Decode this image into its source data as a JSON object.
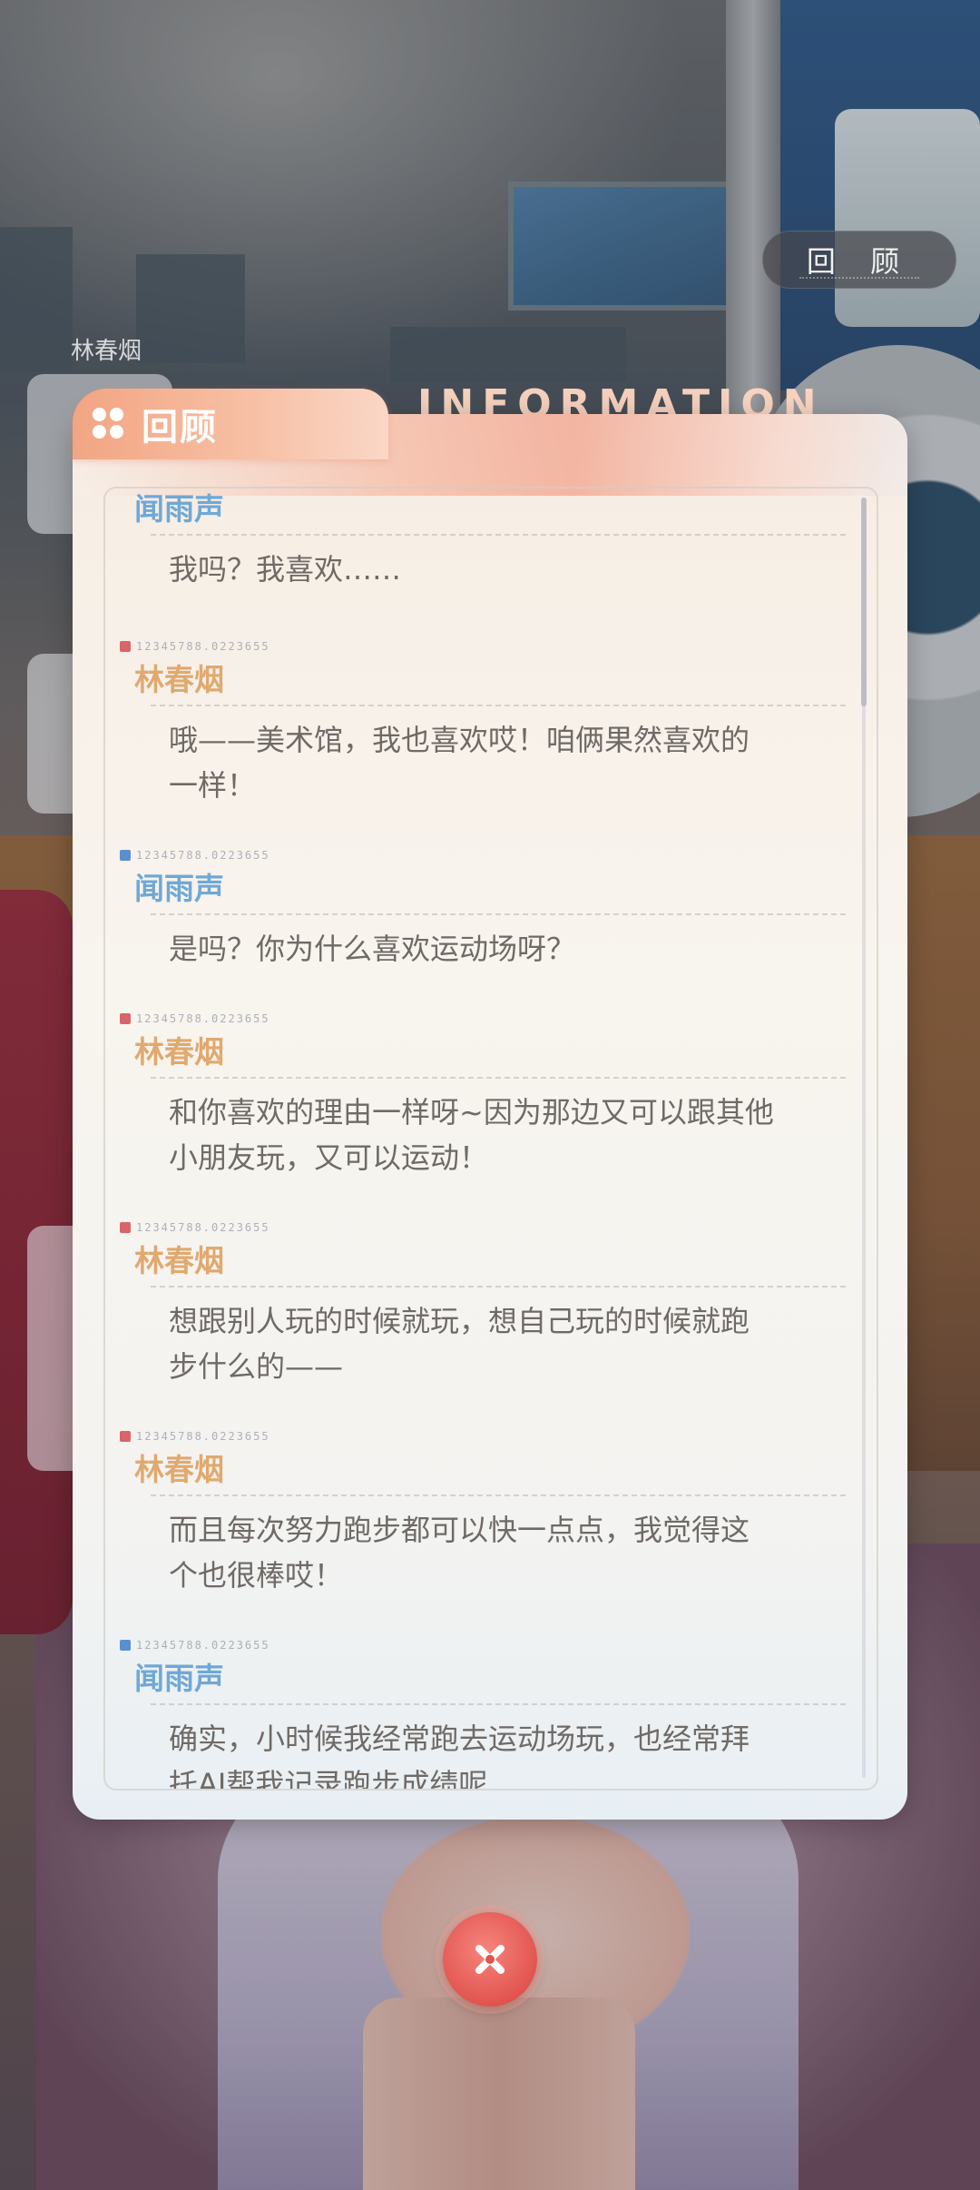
{
  "background": {
    "speaker_name_peek": "林春烟"
  },
  "review_button": {
    "label": "回 顾"
  },
  "panel": {
    "title": "回顾",
    "decor_text": "INFORMATION",
    "accent_color": "#f2a583",
    "close_icon": "close-x-icon"
  },
  "speakers": {
    "wen": {
      "color": "#6fa8d6",
      "tag_color": "#5a8fd0"
    },
    "lin": {
      "color": "#e0a96f",
      "tag_color": "#d9646a"
    }
  },
  "log": [
    {
      "speaker": "闻雨声",
      "who": "wen",
      "code": "",
      "lines": [
        "我吗？我喜欢……"
      ]
    },
    {
      "speaker": "林春烟",
      "who": "lin",
      "code": "12345788.0223655",
      "lines": [
        "哦——美术馆，我也喜欢哎！咱俩果然喜欢的",
        "一样！"
      ]
    },
    {
      "speaker": "闻雨声",
      "who": "wen",
      "code": "12345788.0223655",
      "lines": [
        "是吗？你为什么喜欢运动场呀？"
      ]
    },
    {
      "speaker": "林春烟",
      "who": "lin",
      "code": "12345788.0223655",
      "lines": [
        "和你喜欢的理由一样呀~因为那边又可以跟其他",
        "小朋友玩，又可以运动！"
      ]
    },
    {
      "speaker": "林春烟",
      "who": "lin",
      "code": "12345788.0223655",
      "lines": [
        "想跟别人玩的时候就玩，想自己玩的时候就跑",
        "步什么的——"
      ]
    },
    {
      "speaker": "林春烟",
      "who": "lin",
      "code": "12345788.0223655",
      "lines": [
        "而且每次努力跑步都可以快一点点，我觉得这",
        "个也很棒哎！"
      ]
    },
    {
      "speaker": "闻雨声",
      "who": "wen",
      "code": "12345788.0223655",
      "lines": [
        "确实，小时候我经常跑去运动场玩，也经常拜",
        "托AI帮我记录跑步成绩呢"
      ]
    }
  ]
}
